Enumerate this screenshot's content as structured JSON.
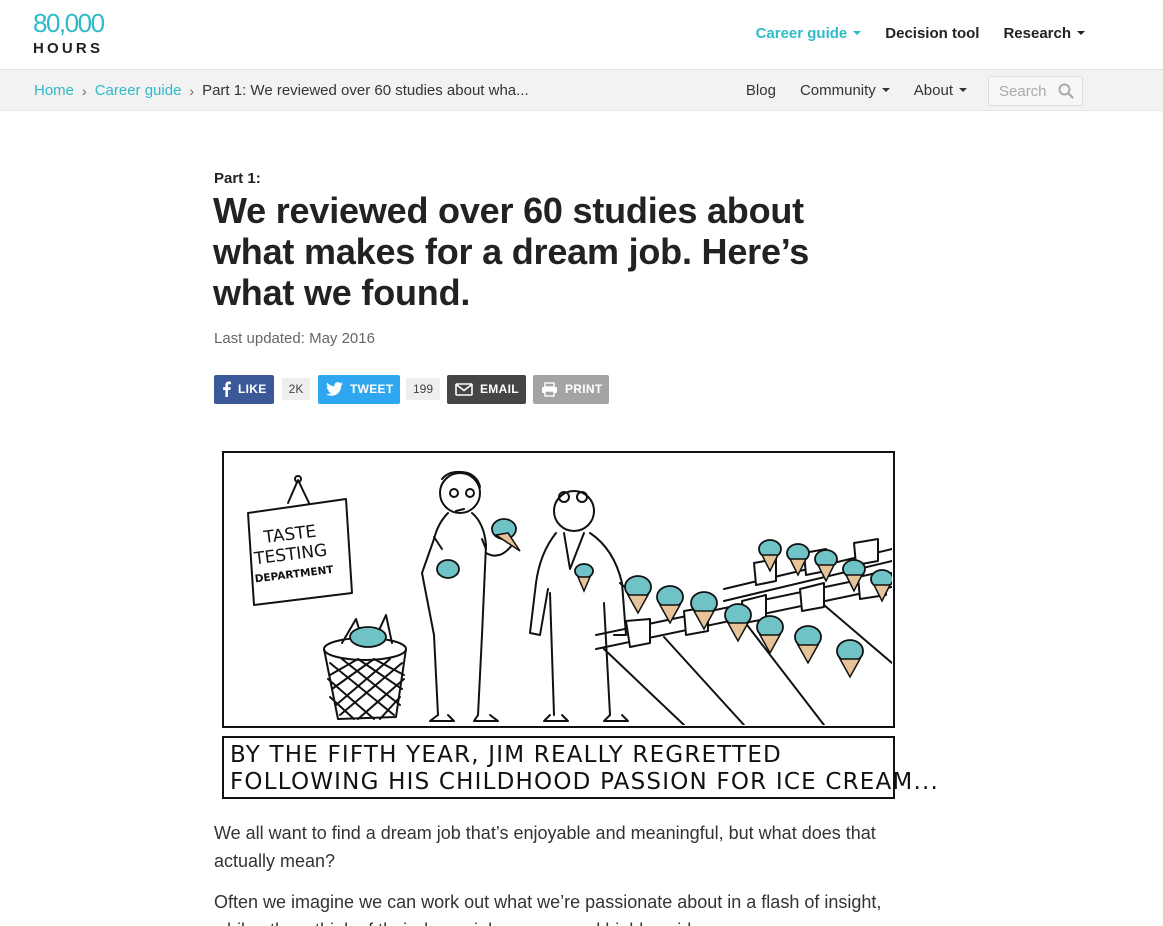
{
  "logo": {
    "number": "80,000",
    "word": "HOURS"
  },
  "main_nav": [
    {
      "label": "Career guide",
      "dropdown": true,
      "active": true
    },
    {
      "label": "Decision tool",
      "dropdown": false,
      "active": false
    },
    {
      "label": "Research",
      "dropdown": true,
      "active": false
    }
  ],
  "breadcrumb": {
    "home": "Home",
    "section": "Career guide",
    "current": "Part 1: We reviewed over 60 studies about wha..."
  },
  "sub_nav": [
    {
      "label": "Blog",
      "dropdown": false
    },
    {
      "label": "Community",
      "dropdown": true
    },
    {
      "label": "About",
      "dropdown": true
    }
  ],
  "search": {
    "placeholder": "Search"
  },
  "article": {
    "kicker": "Part 1:",
    "title": "We reviewed over 60 studies about what makes for a dream job. Here’s what we found.",
    "updated": "Last updated: May 2016",
    "paragraphs": [
      "We all want to find a dream job that’s enjoyable and meaningful, but what does that actually mean?",
      "Often we imagine we can work out what we’re passionate about in a flash of insight, while others think of their dream job as easy and highly paid."
    ]
  },
  "share": {
    "like_label": "LIKE",
    "like_count": "2K",
    "tweet_label": "TWEET",
    "tweet_count": "199",
    "email_label": "EMAIL",
    "print_label": "PRINT"
  },
  "comic": {
    "sign_line1": "TASTE",
    "sign_line2": "TESTING",
    "sign_line3": "DEPARTMENT",
    "caption_line1": "BY THE FIFTH YEAR, JIM REALLY REGRETTED",
    "caption_line2": "FOLLOWING HIS CHILDHOOD PASSION FOR ICE CREAM..."
  },
  "colors": {
    "brand": "#2ebbc8",
    "facebook": "#3b5998",
    "twitter": "#2fa7f0",
    "email": "#454545",
    "print": "#a4a4a4",
    "ice_cream": "#6fc3c7"
  }
}
